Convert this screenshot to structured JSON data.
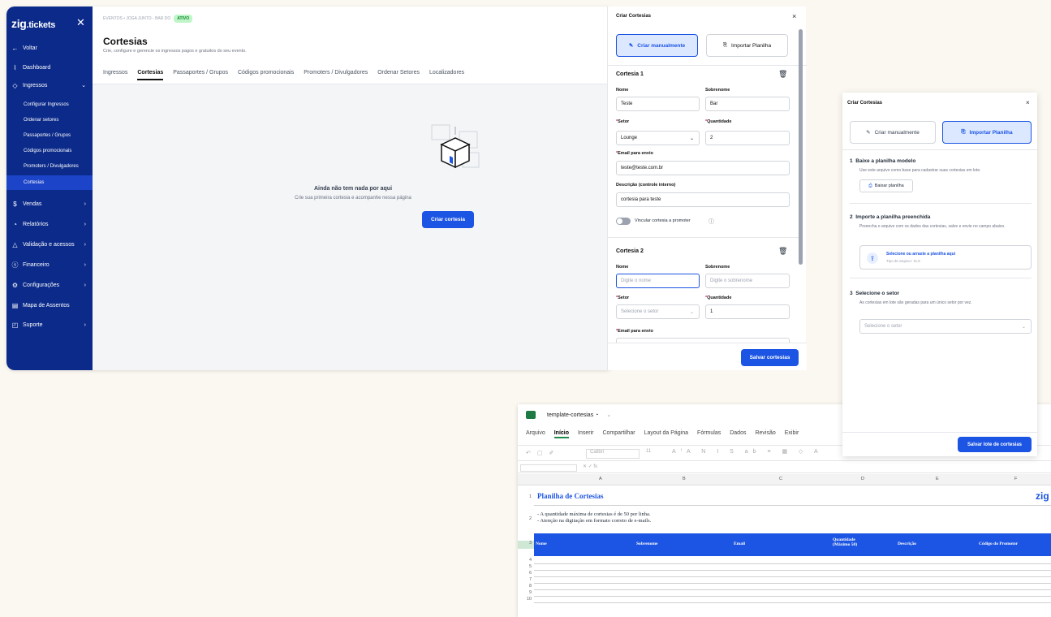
{
  "sidebar": {
    "logo_main": "zig",
    "logo_suffix": ".tickets",
    "back": "Voltar",
    "items": [
      {
        "label": "Dashboard"
      },
      {
        "label": "Ingressos"
      },
      {
        "label": "Vendas"
      },
      {
        "label": "Relatórios"
      },
      {
        "label": "Validação e acessos"
      },
      {
        "label": "Financeiro"
      },
      {
        "label": "Configurações"
      },
      {
        "label": "Mapa de Assentos"
      },
      {
        "label": "Suporte"
      }
    ],
    "subitems": [
      {
        "label": "Configurar Ingressos"
      },
      {
        "label": "Ordenar setores"
      },
      {
        "label": "Passaportes / Grupos"
      },
      {
        "label": "Códigos promocionais"
      },
      {
        "label": "Promoters / Divulgadores"
      },
      {
        "label": "Cortesias"
      }
    ]
  },
  "header": {
    "breadcrumb": "EVENTOS • JOGA JUNTO - BAR DO",
    "status": "ATIVO",
    "title": "Cortesias",
    "subtitle": "Crie, configure e gerencie os ingressos pagos e gratuitos do seu evento.",
    "tabs": [
      "Ingressos",
      "Cortesias",
      "Passaportes / Grupos",
      "Códigos promocionais",
      "Promoters / Divulgadores",
      "Ordenar Setores",
      "Localizadores"
    ]
  },
  "empty": {
    "title": "Ainda não tem nada por aqui",
    "subtitle": "Crie sua primeira cortesia e acompanhe nessa página",
    "button": "Criar cortesia"
  },
  "panel1": {
    "title": "Criar Cortesias",
    "tab_manual": "Criar manualmente",
    "tab_import": "Importar Planilha",
    "c1": {
      "heading": "Cortesia 1",
      "nome_label": "Nome",
      "nome": "Teste",
      "sobrenome_label": "Sobrenome",
      "sobrenome": "Bar",
      "setor_label": "Setor",
      "setor": "Lounge",
      "qtd_label": "Quantidade",
      "qtd": "2",
      "email_label": "Email para envio",
      "email": "teste@teste.com.br",
      "desc_label": "Descrição (controle interno)",
      "desc": "cortesia para teste",
      "vincular": "Vincular cortesia a promoter"
    },
    "c2": {
      "heading": "Cortesia 2",
      "nome_label": "Nome",
      "nome_ph": "Digite o nome",
      "sobrenome_label": "Sobrenome",
      "sobrenome_ph": "Digite o sobrenome",
      "setor_label": "Setor",
      "setor_ph": "Selecione o setor",
      "qtd_label": "Quantidade",
      "qtd": "1",
      "email_label": "Email para envio"
    },
    "save": "Salvar cortesias"
  },
  "panel2": {
    "title": "Criar Cortesias",
    "tab_manual": "Criar manualmente",
    "tab_import": "Importar Planilha",
    "step1": {
      "num": "1",
      "title": "Baixe a planilha modelo",
      "desc": "Use este arquivo como base para cadastrar suas cortesias em lote.",
      "button": "Baixar planilha"
    },
    "step2": {
      "num": "2",
      "title": "Importe a planilha preenchida",
      "desc": "Preencha o arquivo com os dados das cortesias, salve e envie no campo abaixo.",
      "upload": "Selecione ou arraste a planilha aqui",
      "types": "Tipo de arquivo: XLS"
    },
    "step3": {
      "num": "3",
      "title": "Selecione o setor",
      "desc": "As cortesias em lote são geradas para um único setor por vez.",
      "select_ph": "Selecione o setor"
    },
    "save": "Salvar lote de cortesias"
  },
  "sheet": {
    "filename": "template-cortesias",
    "menu": [
      "Arquivo",
      "Início",
      "Inserir",
      "Compartilhar",
      "Layout da Página",
      "Fórmulas",
      "Dados",
      "Revisão",
      "Exibir"
    ],
    "font": "Calibri",
    "font_size": "11",
    "cols": [
      "A",
      "B",
      "C",
      "D",
      "E",
      "F"
    ],
    "title": "Planilha de Cortesias",
    "note1": "- A quantidade máxima de cortesias é de 50 por linha.",
    "note2": "- Atenção na digitação em formato correto de e-mails.",
    "headers": [
      "Nome",
      "Sobrenome",
      "Email",
      "Quantidade (Máximo 50)",
      "Descrição",
      "Código do Promotor"
    ],
    "rows": [
      "1",
      "2",
      "3",
      "4",
      "5",
      "6",
      "7",
      "8",
      "9",
      "10"
    ],
    "brand": "zig"
  },
  "colors": {
    "primary": "#1c54e3",
    "sidebar": "#0b2a8a",
    "active_badge": "#bff5c8"
  }
}
